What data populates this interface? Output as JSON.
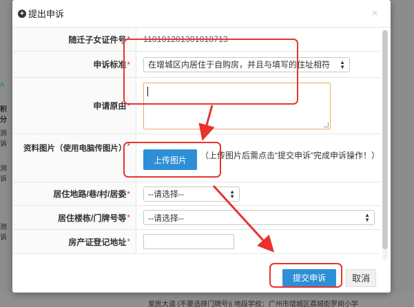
{
  "background": {
    "left_glimpses": [
      "A",
      "积分",
      "测诉",
      "测诉",
      "测诉"
    ],
    "bottom_text": "爱民大道 (不要选择门牌号)| 地段学校：广州市增城区荔城街罗岗小学"
  },
  "modal": {
    "title": "提出申诉",
    "close_symbol": "×",
    "fields": {
      "child_id": {
        "label": "随迁子女证件号",
        "required": "*",
        "value": "110101201301018713"
      },
      "appeal_standard": {
        "label": "申诉标准",
        "required": "*",
        "selected": "在增城区内居住于自购房，并且与填写的住址相符"
      },
      "appeal_reason": {
        "label": "申请原由",
        "required": "*",
        "value": ""
      },
      "photos": {
        "label": "资料图片（使用电脑传图片）",
        "required": "*",
        "upload_label": "上传图片",
        "hint": "（上传图片后需点击“提交申诉”完成申诉操作！）"
      },
      "residence_road": {
        "label": "居住地路/巷/村/居委",
        "required": "*",
        "selected": "--请选择--"
      },
      "residence_building": {
        "label": "居住楼栋/门牌号等",
        "required": "*",
        "selected": "--请选择--"
      },
      "property_address": {
        "label": "房产证登记地址",
        "required": "*",
        "value": ""
      }
    },
    "buttons": {
      "submit": "提交申诉",
      "cancel": "取消"
    }
  },
  "annotations": {
    "color": "#e8322a"
  }
}
